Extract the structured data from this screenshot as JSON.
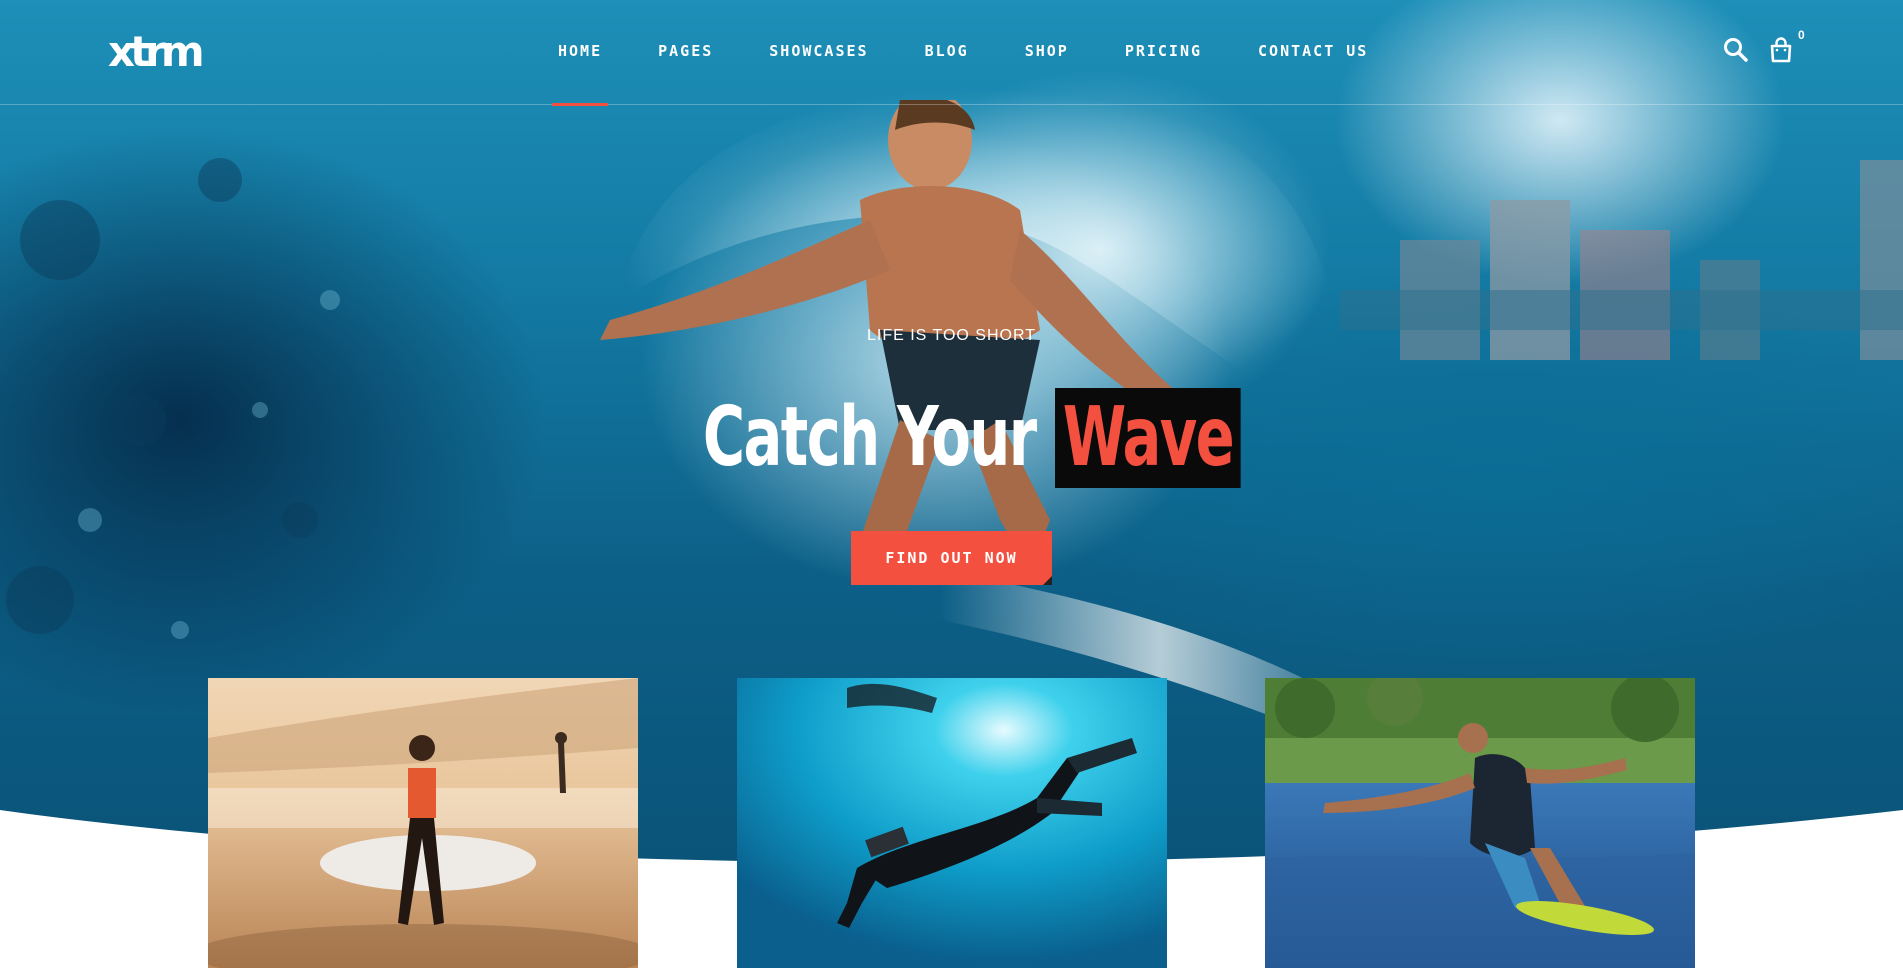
{
  "header": {
    "logo_text": "xtrm",
    "nav": [
      {
        "label": "HOME",
        "active": true
      },
      {
        "label": "PAGES",
        "active": false
      },
      {
        "label": "SHOWCASES",
        "active": false
      },
      {
        "label": "BLOG",
        "active": false
      },
      {
        "label": "SHOP",
        "active": false
      },
      {
        "label": "PRICING",
        "active": false
      },
      {
        "label": "CONTACT US",
        "active": false
      }
    ],
    "icons": [
      "search-icon",
      "cart-icon"
    ],
    "cart_count": "0"
  },
  "hero": {
    "eyebrow": "LIFE IS TOO SHORT",
    "headline_part1": "Catch Your",
    "headline_part2": "Wave",
    "cta_label": "FIND OUT NOW"
  },
  "cards": [
    {
      "subject": "surfer walking on beach at sunset"
    },
    {
      "subject": "scuba diver underwater"
    },
    {
      "subject": "water skier on lake"
    }
  ],
  "colors": {
    "accent": "#f4503f",
    "highlight_bg": "#0a0a0a",
    "ocean": "#137aa3",
    "text": "#ffffff"
  }
}
